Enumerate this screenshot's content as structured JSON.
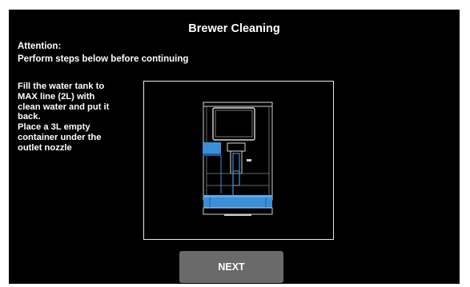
{
  "screen": {
    "title": "Brewer Cleaning",
    "attention_label": "Attention:",
    "attention_text": "Perform steps below before continuing",
    "instructions": [
      "Fill the water tank to",
      "MAX line (2L) with",
      "clean water and put it",
      "back.",
      "Place a 3L empty",
      "container under the",
      "outlet nozzle"
    ],
    "next_label": "NEXT"
  },
  "illustration": {
    "icon": "coffee-machine-icon",
    "highlight_color": "#3a8fd8",
    "outline_color": "#d8d8d8"
  },
  "colors": {
    "background": "#000000",
    "text": "#ffffff",
    "button": "#6a6a6a"
  }
}
